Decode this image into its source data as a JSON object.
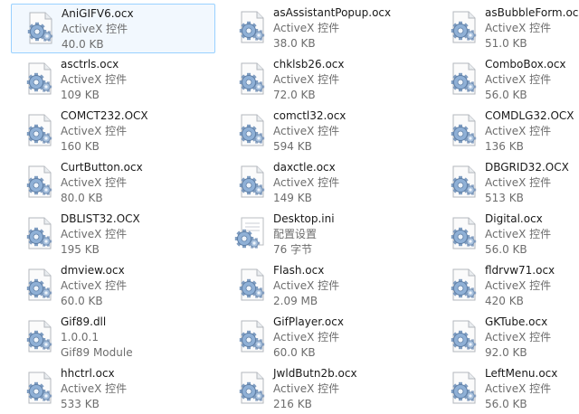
{
  "files": [
    {
      "name": "AniGIFV6.ocx",
      "type": "ActiveX 控件",
      "size": "40.0 KB",
      "icon": "ocx-file-icon",
      "selected": true
    },
    {
      "name": "asAssistantPopup.ocx",
      "type": "ActiveX 控件",
      "size": "38.0 KB",
      "icon": "ocx-file-icon"
    },
    {
      "name": "asBubbleForm.ocx",
      "type": "ActiveX 控件",
      "size": "51.0 KB",
      "icon": "ocx-file-icon"
    },
    {
      "name": "asctrls.ocx",
      "type": "ActiveX 控件",
      "size": "109 KB",
      "icon": "ocx-file-icon"
    },
    {
      "name": "chklsb26.ocx",
      "type": "ActiveX 控件",
      "size": "72.0 KB",
      "icon": "ocx-file-icon"
    },
    {
      "name": "ComboBox.ocx",
      "type": "ActiveX 控件",
      "size": "56.0 KB",
      "icon": "ocx-file-icon"
    },
    {
      "name": "COMCT232.OCX",
      "type": "ActiveX 控件",
      "size": "160 KB",
      "icon": "ocx-file-icon"
    },
    {
      "name": "comctl32.ocx",
      "type": "ActiveX 控件",
      "size": "594 KB",
      "icon": "ocx-file-icon"
    },
    {
      "name": "COMDLG32.OCX",
      "type": "ActiveX 控件",
      "size": "136 KB",
      "icon": "ocx-file-icon"
    },
    {
      "name": "CurtButton.ocx",
      "type": "ActiveX 控件",
      "size": "80.0 KB",
      "icon": "ocx-file-icon"
    },
    {
      "name": "daxctle.ocx",
      "type": "ActiveX 控件",
      "size": "149 KB",
      "icon": "ocx-file-icon"
    },
    {
      "name": "DBGRID32.OCX",
      "type": "ActiveX 控件",
      "size": "513 KB",
      "icon": "ocx-file-icon"
    },
    {
      "name": "DBLIST32.OCX",
      "type": "ActiveX 控件",
      "size": "195 KB",
      "icon": "ocx-file-icon"
    },
    {
      "name": "Desktop.ini",
      "type": "配置设置",
      "size": "76 字节",
      "icon": "ini-settings-file-icon"
    },
    {
      "name": "Digital.ocx",
      "type": "ActiveX 控件",
      "size": "56.0 KB",
      "icon": "ocx-file-icon"
    },
    {
      "name": "dmview.ocx",
      "type": "ActiveX 控件",
      "size": "60.0 KB",
      "icon": "ocx-file-icon"
    },
    {
      "name": "Flash.ocx",
      "type": "ActiveX 控件",
      "size": "2.09 MB",
      "icon": "ocx-file-icon"
    },
    {
      "name": "fldrvw71.ocx",
      "type": "ActiveX 控件",
      "size": "420 KB",
      "icon": "ocx-file-icon"
    },
    {
      "name": "Gif89.dll",
      "type": "1.0.0.1",
      "size": "Gif89 Module",
      "icon": "dll-file-icon"
    },
    {
      "name": "GifPlayer.ocx",
      "type": "ActiveX 控件",
      "size": "60.0 KB",
      "icon": "ocx-file-icon"
    },
    {
      "name": "GKTube.ocx",
      "type": "ActiveX 控件",
      "size": "92.0 KB",
      "icon": "ocx-file-icon"
    },
    {
      "name": "hhctrl.ocx",
      "type": "ActiveX 控件",
      "size": "533 KB",
      "icon": "ocx-file-icon"
    },
    {
      "name": "JwldButn2b.ocx",
      "type": "ActiveX 控件",
      "size": "216 KB",
      "icon": "ocx-file-icon"
    },
    {
      "name": "LeftMenu.ocx",
      "type": "ActiveX 控件",
      "size": "56.0 KB",
      "icon": "ocx-file-icon"
    }
  ],
  "colors": {
    "selection_border": "#99d1ff",
    "selection_fill": "#f2f8fe",
    "name_text": "#1a1a1a",
    "detail_text": "#6d6d6d"
  }
}
